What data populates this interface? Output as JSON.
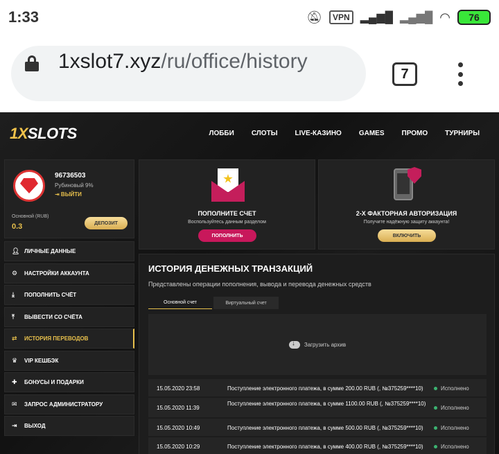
{
  "status_bar": {
    "time": "1:33",
    "vpn": "VPN",
    "battery": "76"
  },
  "browser": {
    "url_host": "1xslot7.xyz",
    "url_path": "/ru/office/history",
    "tab_count": "7"
  },
  "site": {
    "logo": {
      "part1": "1X",
      "part2": "SLOTS"
    },
    "nav": [
      "ЛОББИ",
      "СЛОТЫ",
      "LIVE-КАЗИНО",
      "GAMES",
      "ПРОМО",
      "ТУРНИРЫ"
    ],
    "profile": {
      "id": "96736503",
      "level": "Рубиновый 9%",
      "logout": "⇥ ВЫЙТИ",
      "balance_label": "Основной (RUB)",
      "balance": "0.3",
      "deposit": "ДЕПОЗИТ"
    },
    "menu": [
      {
        "icon": "user-icon",
        "label": "ЛИЧНЫЕ ДАННЫЕ",
        "active": false
      },
      {
        "icon": "gears-icon",
        "label": "НАСТРОЙКИ АККАУНТА",
        "active": false
      },
      {
        "icon": "download-icon",
        "label": "ПОПОЛНИТЬ СЧЁТ",
        "active": false
      },
      {
        "icon": "upload-icon",
        "label": "ВЫВЕСТИ СО СЧЁТА",
        "active": false
      },
      {
        "icon": "transfer-icon",
        "label": "ИСТОРИЯ ПЕРЕВОДОВ",
        "active": true
      },
      {
        "icon": "crown-icon",
        "label": "VIP КЕШБЭК",
        "active": false
      },
      {
        "icon": "gift-icon",
        "label": "БОНУСЫ И ПОДАРКИ",
        "active": false
      },
      {
        "icon": "mail-icon",
        "label": "ЗАПРОС АДМИНИСТРАТОРУ",
        "active": false
      },
      {
        "icon": "exit-icon",
        "label": "ВЫХОД",
        "active": false
      }
    ],
    "cards": [
      {
        "title": "ПОПОЛНИТЕ СЧЕТ",
        "subtitle": "Воспользуйтесь данным разделом",
        "button": "ПОПОЛНИТЬ"
      },
      {
        "title": "2-Х ФАКТОРНАЯ АВТОРИЗАЦИЯ",
        "subtitle": "Получите надёжную защиту аккаунта!",
        "button": "ВКЛЮЧИТЬ"
      }
    ],
    "history": {
      "title": "ИСТОРИЯ ДЕНЕЖНЫХ ТРАНЗАКЦИЙ",
      "description": "Представлены операции пополнения, вывода и перевода денежных средств",
      "tabs": [
        "Основной счет",
        "Виртуальный счет"
      ],
      "archive": "Загрузить архив",
      "transactions": [
        {
          "date": "15.05.2020 23:58",
          "text": "Поступление электронного платежа, в сумме 200.00 RUB (, №375259****10)",
          "status": "Исполнено"
        },
        {
          "date": "15.05.2020 11:39",
          "text": "Поступление электронного платежа, в сумме 1100.00 RUB (, №375259****10)",
          "status": "Исполнено"
        },
        {
          "date": "15.05.2020 10:49",
          "text": "Поступление электронного платежа, в сумме 500.00 RUB (, №375259****10)",
          "status": "Исполнено"
        },
        {
          "date": "15.05.2020 10:29",
          "text": "Поступление электронного платежа, в сумме 400.00 RUB (, №375259****10)",
          "status": "Исполнено"
        }
      ]
    }
  }
}
